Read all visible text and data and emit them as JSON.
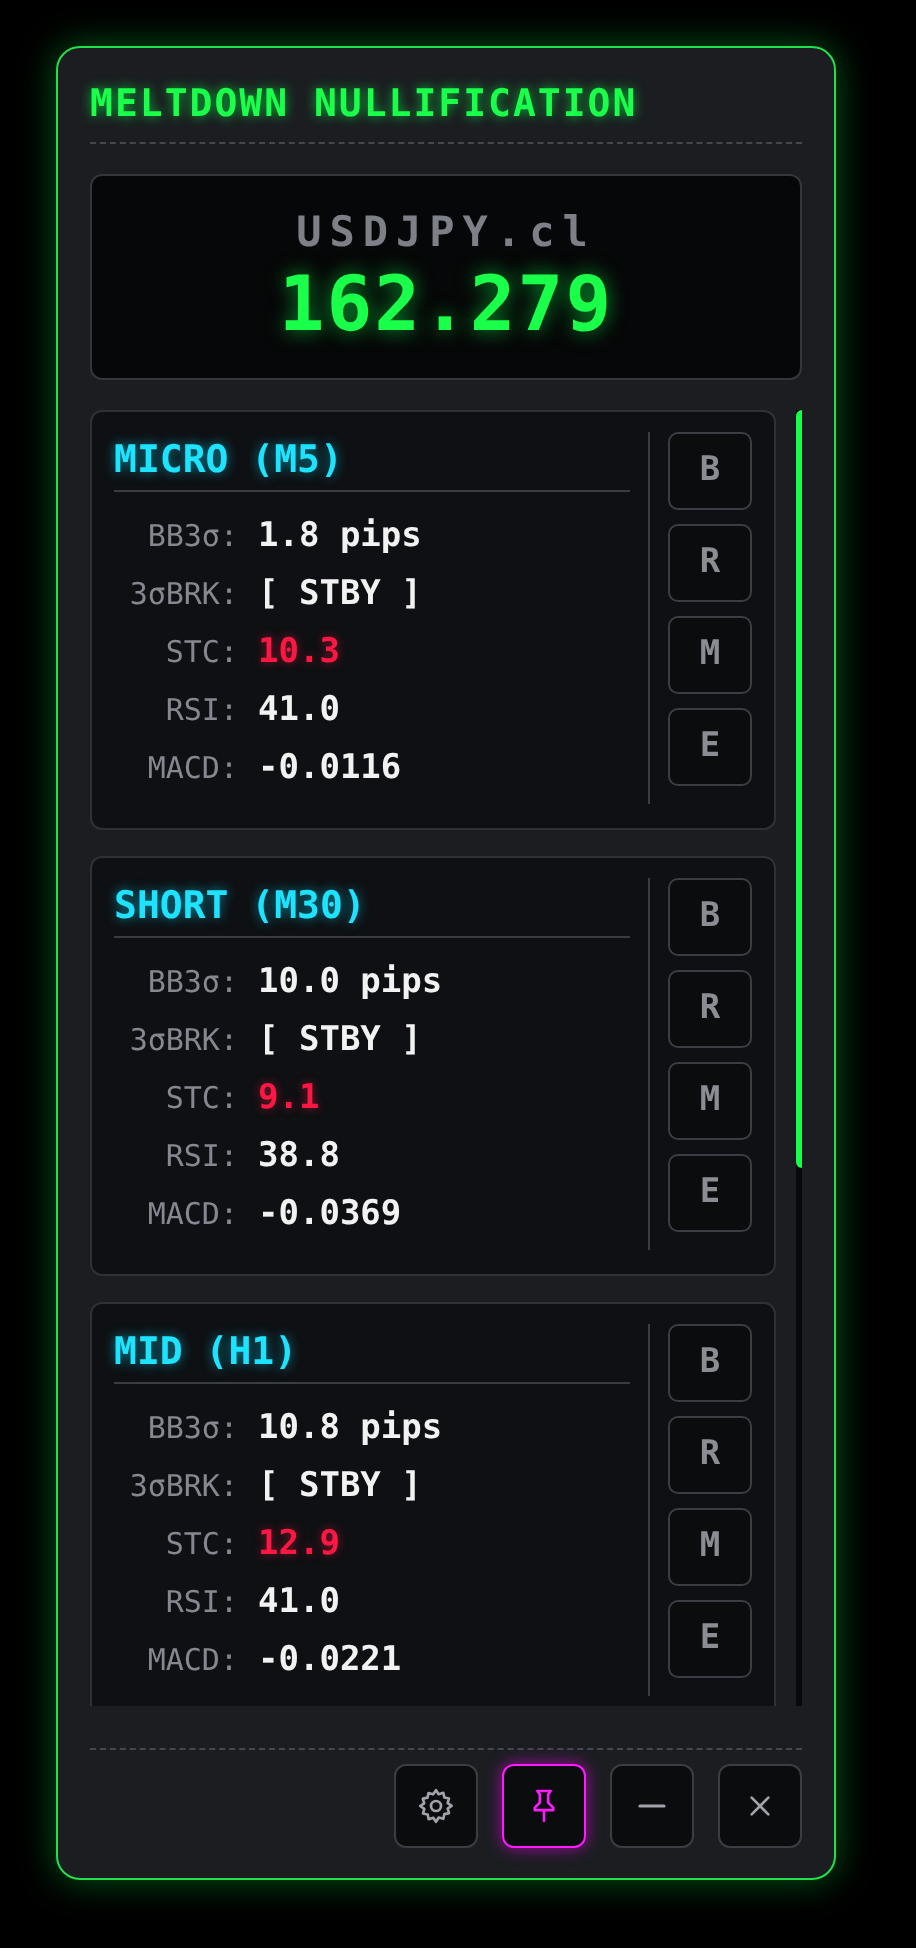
{
  "title": "MELTDOWN NULLIFICATION",
  "quote": {
    "symbol": "USDJPY.cl",
    "price": "162.279"
  },
  "panels": [
    {
      "title": "MICRO (M5)",
      "rows": [
        {
          "label": "BB3σ:",
          "value": "1.8 pips",
          "alert": false
        },
        {
          "label": "3σBRK:",
          "value": "[ STBY ]",
          "alert": false
        },
        {
          "label": "STC:",
          "value": "10.3",
          "alert": true
        },
        {
          "label": "RSI:",
          "value": "41.0",
          "alert": false
        },
        {
          "label": "MACD:",
          "value": "-0.0116",
          "alert": false
        }
      ],
      "buttons": [
        "B",
        "R",
        "M",
        "E"
      ]
    },
    {
      "title": "SHORT (M30)",
      "rows": [
        {
          "label": "BB3σ:",
          "value": "10.0 pips",
          "alert": false
        },
        {
          "label": "3σBRK:",
          "value": "[ STBY ]",
          "alert": false
        },
        {
          "label": "STC:",
          "value": "9.1",
          "alert": true
        },
        {
          "label": "RSI:",
          "value": "38.8",
          "alert": false
        },
        {
          "label": "MACD:",
          "value": "-0.0369",
          "alert": false
        }
      ],
      "buttons": [
        "B",
        "R",
        "M",
        "E"
      ]
    },
    {
      "title": "MID (H1)",
      "rows": [
        {
          "label": "BB3σ:",
          "value": "10.8 pips",
          "alert": false
        },
        {
          "label": "3σBRK:",
          "value": "[ STBY ]",
          "alert": false
        },
        {
          "label": "STC:",
          "value": "12.9",
          "alert": true
        },
        {
          "label": "RSI:",
          "value": "41.0",
          "alert": false
        },
        {
          "label": "MACD:",
          "value": "-0.0221",
          "alert": false
        }
      ],
      "buttons": [
        "B",
        "R",
        "M",
        "E"
      ]
    }
  ],
  "toolbar": [
    {
      "kind": "settings",
      "active": false
    },
    {
      "kind": "pin",
      "active": true
    },
    {
      "kind": "minimize",
      "active": false
    },
    {
      "kind": "close",
      "active": false
    }
  ]
}
